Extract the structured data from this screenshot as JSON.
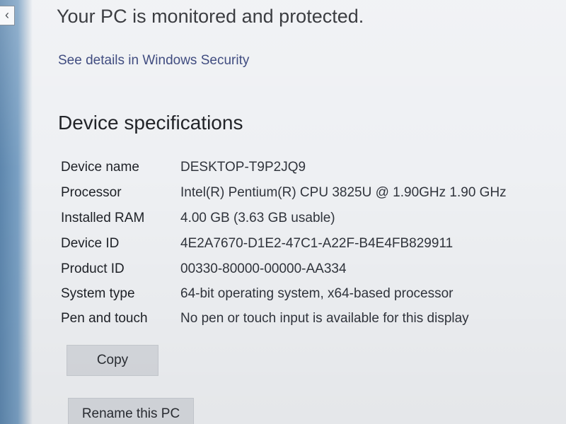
{
  "nav": {
    "back_glyph": "‹",
    "back_icon": "back-arrow-icon"
  },
  "security": {
    "heading": "Your PC is monitored and protected.",
    "link": "See details in Windows Security"
  },
  "specs": {
    "heading": "Device specifications",
    "rows": [
      {
        "label": "Device name",
        "value": "DESKTOP-T9P2JQ9"
      },
      {
        "label": "Processor",
        "value": "Intel(R) Pentium(R) CPU 3825U @ 1.90GHz   1.90 GHz"
      },
      {
        "label": "Installed RAM",
        "value": "4.00 GB (3.63 GB usable)"
      },
      {
        "label": "Device ID",
        "value": "4E2A7670-D1E2-47C1-A22F-B4E4FB829911"
      },
      {
        "label": "Product ID",
        "value": "00330-80000-00000-AA334"
      },
      {
        "label": "System type",
        "value": "64-bit operating system, x64-based processor"
      },
      {
        "label": "Pen and touch",
        "value": "No pen or touch input is available for this display"
      }
    ]
  },
  "actions": {
    "copy_label": "Copy",
    "rename_label": "Rename this PC"
  },
  "colors": {
    "link": "#27356f",
    "button_bg": "#d6d9de",
    "background": "#eef0f3",
    "sidebar_accent": "#5d86ad"
  }
}
